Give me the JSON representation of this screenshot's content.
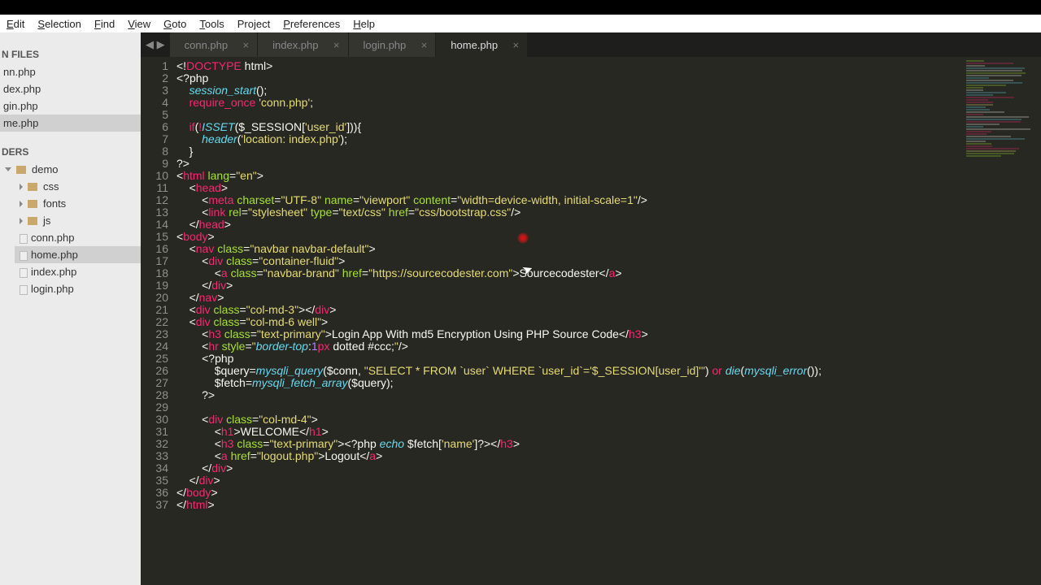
{
  "menu": [
    "Edit",
    "Selection",
    "Find",
    "View",
    "Goto",
    "Tools",
    "Project",
    "Preferences",
    "Help"
  ],
  "menu_u": [
    0,
    0,
    0,
    0,
    0,
    0,
    3,
    0,
    0
  ],
  "sidebar": {
    "open_files_header": "N FILES",
    "open_files": [
      "nn.php",
      "dex.php",
      "gin.php",
      "me.php"
    ],
    "open_sel": 3,
    "folders_header": "DERS",
    "root": "demo",
    "folders": [
      "css",
      "fonts",
      "js"
    ],
    "files": [
      "conn.php",
      "home.php",
      "index.php",
      "login.php"
    ],
    "file_sel": 1
  },
  "tabs": [
    {
      "label": "conn.php",
      "active": false
    },
    {
      "label": "index.php",
      "active": false
    },
    {
      "label": "login.php",
      "active": false
    },
    {
      "label": "home.php",
      "active": true
    }
  ],
  "lines": 37,
  "code": [
    {
      "indent": 0,
      "parts": [
        [
          "w",
          "<!"
        ],
        [
          "red",
          "DOCTYPE"
        ],
        [
          "w",
          " html>"
        ]
      ]
    },
    {
      "indent": 0,
      "parts": [
        [
          "w",
          "<?php"
        ]
      ]
    },
    {
      "indent": 1,
      "parts": [
        [
          "blue",
          "session_start"
        ],
        [
          "w",
          "();"
        ]
      ]
    },
    {
      "indent": 1,
      "parts": [
        [
          "red",
          "require_once"
        ],
        [
          "w",
          " "
        ],
        [
          "yellow",
          "'conn.php'"
        ],
        [
          "w",
          ";"
        ]
      ]
    },
    {
      "indent": 0,
      "parts": []
    },
    {
      "indent": 1,
      "parts": [
        [
          "red",
          "if"
        ],
        [
          "w",
          "("
        ],
        [
          "red",
          "!"
        ],
        [
          "blue",
          "ISSET"
        ],
        [
          "w",
          "($_SESSION["
        ],
        [
          "yellow",
          "'user_id'"
        ],
        [
          "w",
          "])){"
        ]
      ]
    },
    {
      "indent": 2,
      "parts": [
        [
          "blue",
          "header"
        ],
        [
          "w",
          "("
        ],
        [
          "yellow",
          "'location: index.php'"
        ],
        [
          "w",
          ");"
        ]
      ]
    },
    {
      "indent": 1,
      "parts": [
        [
          "w",
          "}"
        ]
      ]
    },
    {
      "indent": 0,
      "parts": [
        [
          "w",
          "?>"
        ]
      ]
    },
    {
      "indent": 0,
      "parts": [
        [
          "w",
          "<"
        ],
        [
          "red",
          "html"
        ],
        [
          "w",
          " "
        ],
        [
          "green",
          "lang"
        ],
        [
          "w",
          "="
        ],
        [
          "yellow",
          "\"en\""
        ],
        [
          "w",
          ">"
        ]
      ]
    },
    {
      "indent": 1,
      "parts": [
        [
          "w",
          "<"
        ],
        [
          "red",
          "head"
        ],
        [
          "w",
          ">"
        ]
      ]
    },
    {
      "indent": 2,
      "parts": [
        [
          "w",
          "<"
        ],
        [
          "red",
          "meta"
        ],
        [
          "w",
          " "
        ],
        [
          "green",
          "charset"
        ],
        [
          "w",
          "="
        ],
        [
          "yellow",
          "\"UTF-8\""
        ],
        [
          "w",
          " "
        ],
        [
          "green",
          "name"
        ],
        [
          "w",
          "="
        ],
        [
          "yellow",
          "\"viewport\""
        ],
        [
          "w",
          " "
        ],
        [
          "green",
          "content"
        ],
        [
          "w",
          "="
        ],
        [
          "yellow",
          "\"width=device-width, initial-scale=1\""
        ],
        [
          "w",
          "/>"
        ]
      ]
    },
    {
      "indent": 2,
      "parts": [
        [
          "w",
          "<"
        ],
        [
          "red",
          "link"
        ],
        [
          "w",
          " "
        ],
        [
          "green",
          "rel"
        ],
        [
          "w",
          "="
        ],
        [
          "yellow",
          "\"stylesheet\""
        ],
        [
          "w",
          " "
        ],
        [
          "green",
          "type"
        ],
        [
          "w",
          "="
        ],
        [
          "yellow",
          "\"text/css\""
        ],
        [
          "w",
          " "
        ],
        [
          "green",
          "href"
        ],
        [
          "w",
          "="
        ],
        [
          "yellow",
          "\"css/bootstrap.css\""
        ],
        [
          "w",
          "/>"
        ]
      ]
    },
    {
      "indent": 1,
      "parts": [
        [
          "w",
          "</"
        ],
        [
          "red",
          "head"
        ],
        [
          "w",
          ">"
        ]
      ]
    },
    {
      "indent": 0,
      "parts": [
        [
          "w",
          "<"
        ],
        [
          "red",
          "body"
        ],
        [
          "w",
          ">"
        ]
      ]
    },
    {
      "indent": 1,
      "parts": [
        [
          "w",
          "<"
        ],
        [
          "red",
          "nav"
        ],
        [
          "w",
          " "
        ],
        [
          "green",
          "class"
        ],
        [
          "w",
          "="
        ],
        [
          "yellow",
          "\"navbar navbar-default\""
        ],
        [
          "w",
          ">"
        ]
      ]
    },
    {
      "indent": 2,
      "parts": [
        [
          "w",
          "<"
        ],
        [
          "red",
          "div"
        ],
        [
          "w",
          " "
        ],
        [
          "green",
          "class"
        ],
        [
          "w",
          "="
        ],
        [
          "yellow",
          "\"container-fluid\""
        ],
        [
          "w",
          ">"
        ]
      ]
    },
    {
      "indent": 3,
      "parts": [
        [
          "w",
          "<"
        ],
        [
          "red",
          "a"
        ],
        [
          "w",
          " "
        ],
        [
          "green",
          "class"
        ],
        [
          "w",
          "="
        ],
        [
          "yellow",
          "\"navbar-brand\""
        ],
        [
          "w",
          " "
        ],
        [
          "green",
          "href"
        ],
        [
          "w",
          "="
        ],
        [
          "yellow",
          "\"https://sourcecodester.com\""
        ],
        [
          "w",
          ">Sourcecodester</"
        ],
        [
          "red",
          "a"
        ],
        [
          "w",
          ">"
        ]
      ]
    },
    {
      "indent": 2,
      "parts": [
        [
          "w",
          "</"
        ],
        [
          "red",
          "div"
        ],
        [
          "w",
          ">"
        ]
      ]
    },
    {
      "indent": 1,
      "parts": [
        [
          "w",
          "</"
        ],
        [
          "red",
          "nav"
        ],
        [
          "w",
          ">"
        ]
      ]
    },
    {
      "indent": 1,
      "parts": [
        [
          "w",
          "<"
        ],
        [
          "red",
          "div"
        ],
        [
          "w",
          " "
        ],
        [
          "green",
          "class"
        ],
        [
          "w",
          "="
        ],
        [
          "yellow",
          "\"col-md-3\""
        ],
        [
          "w",
          "></"
        ],
        [
          "red",
          "div"
        ],
        [
          "w",
          ">"
        ]
      ]
    },
    {
      "indent": 1,
      "parts": [
        [
          "w",
          "<"
        ],
        [
          "red",
          "div"
        ],
        [
          "w",
          " "
        ],
        [
          "green",
          "class"
        ],
        [
          "w",
          "="
        ],
        [
          "yellow",
          "\"col-md-6 well\""
        ],
        [
          "w",
          ">"
        ]
      ]
    },
    {
      "indent": 2,
      "parts": [
        [
          "w",
          "<"
        ],
        [
          "red",
          "h3"
        ],
        [
          "w",
          " "
        ],
        [
          "green",
          "class"
        ],
        [
          "w",
          "="
        ],
        [
          "yellow",
          "\"text-primary\""
        ],
        [
          "w",
          ">Login App With md5 Encryption Using PHP Source Code</"
        ],
        [
          "red",
          "h3"
        ],
        [
          "w",
          ">"
        ]
      ]
    },
    {
      "indent": 2,
      "parts": [
        [
          "w",
          "<"
        ],
        [
          "red",
          "hr"
        ],
        [
          "w",
          " "
        ],
        [
          "green",
          "style"
        ],
        [
          "w",
          "="
        ],
        [
          "yellow",
          "\""
        ],
        [
          "blue",
          "border-top"
        ],
        [
          "w",
          ":"
        ],
        [
          "purple",
          "1"
        ],
        [
          "red",
          "px"
        ],
        [
          "w",
          " dotted #ccc;"
        ],
        [
          "yellow",
          "\""
        ],
        [
          "w",
          "/>"
        ]
      ]
    },
    {
      "indent": 2,
      "parts": [
        [
          "w",
          "<?php"
        ]
      ]
    },
    {
      "indent": 3,
      "parts": [
        [
          "w",
          "$query="
        ],
        [
          "blue",
          "mysqli_query"
        ],
        [
          "w",
          "($conn, "
        ],
        [
          "yellow",
          "\"SELECT * FROM `user` WHERE `user_id`='$_SESSION[user_id]'\""
        ],
        [
          "w",
          ") "
        ],
        [
          "red",
          "or"
        ],
        [
          "w",
          " "
        ],
        [
          "blue",
          "die"
        ],
        [
          "w",
          "("
        ],
        [
          "blue",
          "mysqli_error"
        ],
        [
          "w",
          "());"
        ]
      ]
    },
    {
      "indent": 3,
      "parts": [
        [
          "w",
          "$fetch="
        ],
        [
          "blue",
          "mysqli_fetch_array"
        ],
        [
          "w",
          "($query);"
        ]
      ]
    },
    {
      "indent": 2,
      "parts": [
        [
          "w",
          "?>"
        ]
      ]
    },
    {
      "indent": 0,
      "parts": []
    },
    {
      "indent": 2,
      "parts": [
        [
          "w",
          "<"
        ],
        [
          "red",
          "div"
        ],
        [
          "w",
          " "
        ],
        [
          "green",
          "class"
        ],
        [
          "w",
          "="
        ],
        [
          "yellow",
          "\"col-md-4\""
        ],
        [
          "w",
          ">"
        ]
      ]
    },
    {
      "indent": 3,
      "parts": [
        [
          "w",
          "<"
        ],
        [
          "red",
          "h1"
        ],
        [
          "w",
          ">WELCOME</"
        ],
        [
          "red",
          "h1"
        ],
        [
          "w",
          ">"
        ]
      ]
    },
    {
      "indent": 3,
      "parts": [
        [
          "w",
          "<"
        ],
        [
          "red",
          "h3"
        ],
        [
          "w",
          " "
        ],
        [
          "green",
          "class"
        ],
        [
          "w",
          "="
        ],
        [
          "yellow",
          "\"text-primary\""
        ],
        [
          "w",
          "><?php "
        ],
        [
          "blue",
          "echo"
        ],
        [
          "w",
          " $fetch["
        ],
        [
          "yellow",
          "'name'"
        ],
        [
          "w",
          "]?></"
        ],
        [
          "red",
          "h3"
        ],
        [
          "w",
          ">"
        ]
      ]
    },
    {
      "indent": 3,
      "parts": [
        [
          "w",
          "<"
        ],
        [
          "red",
          "a"
        ],
        [
          "w",
          " "
        ],
        [
          "green",
          "href"
        ],
        [
          "w",
          "="
        ],
        [
          "yellow",
          "\"logout.php\""
        ],
        [
          "w",
          ">Logout</"
        ],
        [
          "red",
          "a"
        ],
        [
          "w",
          ">"
        ]
      ]
    },
    {
      "indent": 2,
      "parts": [
        [
          "w",
          "</"
        ],
        [
          "red",
          "div"
        ],
        [
          "w",
          ">"
        ]
      ]
    },
    {
      "indent": 1,
      "parts": [
        [
          "w",
          "</"
        ],
        [
          "red",
          "div"
        ],
        [
          "w",
          ">"
        ]
      ]
    },
    {
      "indent": 0,
      "parts": [
        [
          "w",
          "</"
        ],
        [
          "red",
          "body"
        ],
        [
          "w",
          ">"
        ]
      ]
    },
    {
      "indent": 0,
      "parts": [
        [
          "w",
          "</"
        ],
        [
          "red",
          "html"
        ],
        [
          "w",
          ">"
        ]
      ]
    }
  ]
}
